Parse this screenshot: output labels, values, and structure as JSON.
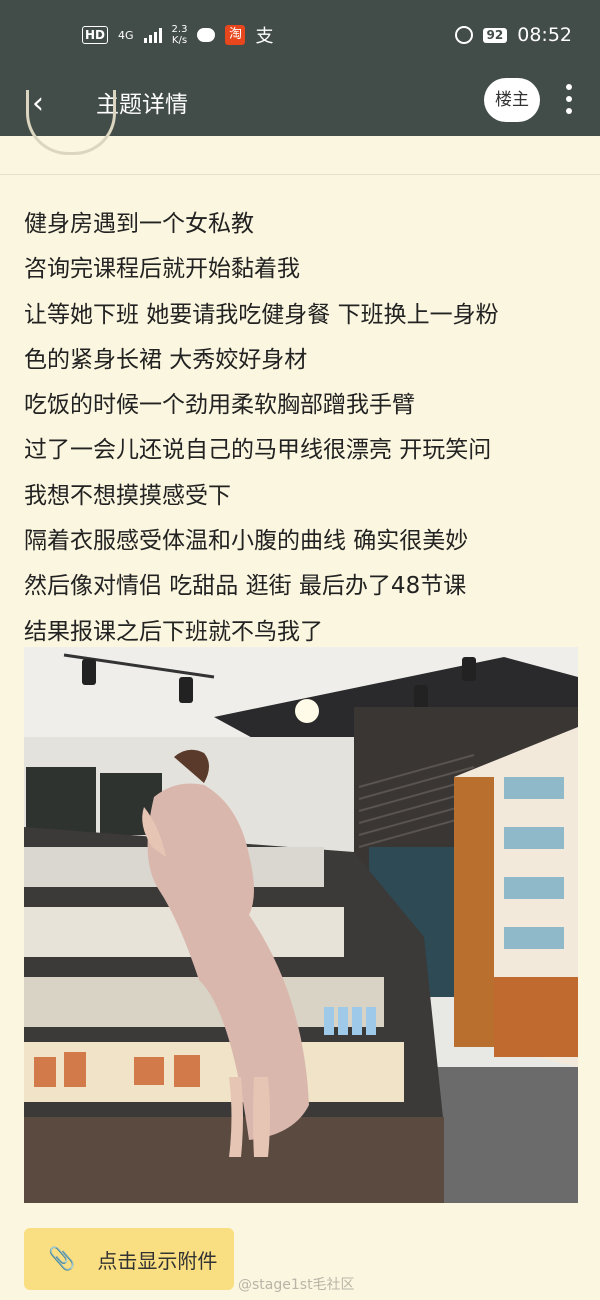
{
  "status_bar": {
    "hd": "HD",
    "network": "4G",
    "speed_value": "2.3",
    "speed_unit": "K/s",
    "taobao_icon": "淘",
    "alipay_icon": "支",
    "battery": "92",
    "time": "08:52"
  },
  "nav": {
    "back_icon": "‹",
    "title": "主题详情",
    "host_button": "楼主",
    "more_icon": "more-vertical-icon"
  },
  "post": {
    "lines": [
      "健身房遇到一个女私教",
      "咨询完课程后就开始黏着我",
      "让等她下班 她要请我吃健身餐 下班换上一身粉",
      "色的紧身长裙 大秀姣好身材",
      "吃饭的时候一个劲用柔软胸部蹭我手臂",
      "过了一会儿还说自己的马甲线很漂亮 开玩笑问",
      "我想不想摸摸感受下",
      "隔着衣服感受体温和小腹的曲线 确实很美妙",
      "然后像对情侣 吃甜品 逛街 最后办了48节课",
      "结果报课之后下班就不鸟我了"
    ]
  },
  "attachment": {
    "icon": "paperclip-icon",
    "label": "点击显示附件"
  },
  "watermark": "@stage1st毛社区",
  "colors": {
    "bar": "#424c49",
    "background": "#fbf6df",
    "attach_button": "#fadf82"
  }
}
